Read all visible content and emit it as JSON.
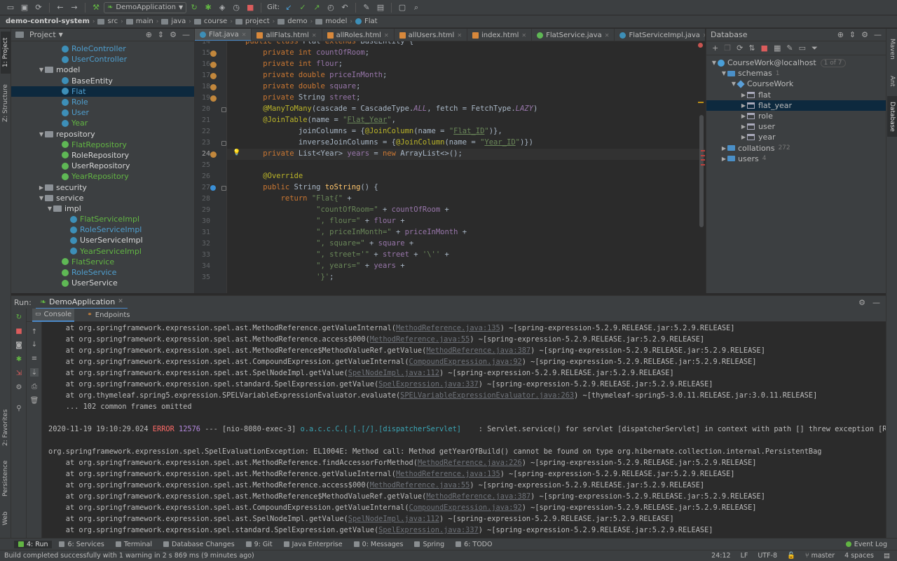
{
  "toolbar": {
    "run_config": "DemoApplication",
    "git_label": "Git:"
  },
  "breadcrumb": [
    "demo-control-system",
    "src",
    "main",
    "java",
    "course",
    "project",
    "demo",
    "model",
    "Flat"
  ],
  "left_strip": {
    "project_tab": "1: Project",
    "structure_tab": "Z: Structure",
    "favorites_tab": "2: Favorites",
    "persistence_tab": "Persistence",
    "web_tab": "Web"
  },
  "right_strip": {
    "maven_tab": "Maven",
    "ant_tab": "Ant",
    "database_tab": "Database"
  },
  "project": {
    "title": "Project",
    "tree": [
      {
        "label": "RoleController",
        "kind": "class",
        "color": "blue",
        "indent": 6
      },
      {
        "label": "UserController",
        "kind": "class",
        "color": "blue",
        "indent": 6
      },
      {
        "label": "model",
        "kind": "package",
        "color": "white",
        "indent": 4,
        "open": true
      },
      {
        "label": "BaseEntity",
        "kind": "class",
        "color": "white",
        "indent": 6
      },
      {
        "label": "Flat",
        "kind": "class",
        "color": "blue",
        "indent": 6,
        "selected": true
      },
      {
        "label": "Role",
        "kind": "class",
        "color": "blue",
        "indent": 6
      },
      {
        "label": "User",
        "kind": "class",
        "color": "blue",
        "indent": 6
      },
      {
        "label": "Year",
        "kind": "class",
        "color": "green",
        "indent": 6
      },
      {
        "label": "repository",
        "kind": "package",
        "color": "white",
        "indent": 4,
        "open": true
      },
      {
        "label": "FlatRepository",
        "kind": "interface",
        "color": "green",
        "indent": 6
      },
      {
        "label": "RoleRepository",
        "kind": "interface",
        "color": "white",
        "indent": 6
      },
      {
        "label": "UserRepository",
        "kind": "interface",
        "color": "white",
        "indent": 6
      },
      {
        "label": "YearRepository",
        "kind": "interface",
        "color": "green",
        "indent": 6
      },
      {
        "label": "security",
        "kind": "package",
        "color": "white",
        "indent": 4,
        "open": false
      },
      {
        "label": "service",
        "kind": "package",
        "color": "white",
        "indent": 4,
        "open": true
      },
      {
        "label": "impl",
        "kind": "package",
        "color": "white",
        "indent": 5,
        "open": true
      },
      {
        "label": "FlatServiceImpl",
        "kind": "class",
        "color": "green",
        "indent": 7
      },
      {
        "label": "RoleServiceImpl",
        "kind": "class",
        "color": "blue",
        "indent": 7
      },
      {
        "label": "UserServiceImpl",
        "kind": "class",
        "color": "white",
        "indent": 7
      },
      {
        "label": "YearServiceImpl",
        "kind": "class",
        "color": "green",
        "indent": 7
      },
      {
        "label": "FlatService",
        "kind": "interface",
        "color": "green",
        "indent": 6
      },
      {
        "label": "RoleService",
        "kind": "interface",
        "color": "blue",
        "indent": 6
      },
      {
        "label": "UserService",
        "kind": "interface",
        "color": "white",
        "indent": 6
      }
    ]
  },
  "editor_tabs": [
    {
      "label": "Flat.java",
      "type": "java-c",
      "active": true
    },
    {
      "label": "allFlats.html",
      "type": "html"
    },
    {
      "label": "allRoles.html",
      "type": "html"
    },
    {
      "label": "allUsers.html",
      "type": "html"
    },
    {
      "label": "index.html",
      "type": "html"
    },
    {
      "label": "FlatService.java",
      "type": "java-i"
    },
    {
      "label": "FlatServiceImpl.java",
      "type": "java-c"
    },
    {
      "label": "FlatController.ja",
      "type": "java-c"
    }
  ],
  "editor": {
    "current_line": 24,
    "lines": [
      {
        "n": 14,
        "html": "<span class='kw'>public class</span> Flat <span class='kw'>extends</span> BaseEntity {"
      },
      {
        "n": 15,
        "mark": "field",
        "html": "    <span class='kw'>private int</span> <span class='fld'>countOfRoom</span>;"
      },
      {
        "n": 16,
        "mark": "field",
        "html": "    <span class='kw'>private int</span> <span class='fld'>flour</span>;"
      },
      {
        "n": 17,
        "mark": "field",
        "html": "    <span class='kw'>private double</span> <span class='fld'>priceInMonth</span>;"
      },
      {
        "n": 18,
        "mark": "field",
        "html": "    <span class='kw'>private double</span> <span class='fld'>square</span>;"
      },
      {
        "n": 19,
        "mark": "field",
        "html": "    <span class='kw'>private</span> String <span class='fld'>street</span>;"
      },
      {
        "n": 20,
        "fold": true,
        "html": "    <span class='ann'>@ManyToMany</span>(cascade = CascadeType.<span class='fld ital'>ALL</span>, fetch = FetchType.<span class='fld ital'>LAZY</span>)"
      },
      {
        "n": 21,
        "html": "    <span class='ann'>@JoinTable</span>(name = <span class='str'>\"<span class='uline'>Flat_Year</span>\"</span>,"
      },
      {
        "n": 22,
        "html": "            joinColumns = {<span class='ann'>@JoinColumn</span>(name = <span class='str'>\"<span class='uline'>Flat_ID</span>\"</span>)},"
      },
      {
        "n": 23,
        "fold": true,
        "html": "            inverseJoinColumns = {<span class='ann'>@JoinColumn</span>(name = <span class='str'>\"<span class='uline'>Year_ID</span>\"</span>)})"
      },
      {
        "n": 24,
        "mark": "field",
        "html": "    <span class='kw'>private</span> List&lt;Year&gt; <span class='fld'>years</span> = <span class='kw'>new</span> ArrayList&lt;&gt;();"
      },
      {
        "n": 25,
        "html": ""
      },
      {
        "n": 26,
        "html": "    <span class='ann'>@Override</span>"
      },
      {
        "n": 27,
        "mark": "override",
        "fold": true,
        "html": "    <span class='kw'>public</span> String <span class='fnc'>toString</span>() {"
      },
      {
        "n": 28,
        "html": "        <span class='kw'>return</span> <span class='str'>\"Flat{\"</span> +"
      },
      {
        "n": 29,
        "html": "                <span class='str'>\"countOfRoom=\"</span> + <span class='fld'>countOfRoom</span> +"
      },
      {
        "n": 30,
        "html": "                <span class='str'>\", flour=\"</span> + <span class='fld'>flour</span> +"
      },
      {
        "n": 31,
        "html": "                <span class='str'>\", priceInMonth=\"</span> + <span class='fld'>priceInMonth</span> +"
      },
      {
        "n": 32,
        "html": "                <span class='str'>\", square=\"</span> + <span class='fld'>square</span> +"
      },
      {
        "n": 33,
        "html": "                <span class='str'>\", street='\"</span> + <span class='fld'>street</span> + <span class='str'>'\\''</span> +"
      },
      {
        "n": 34,
        "html": "                <span class='str'>\", years=\"</span> + <span class='fld'>years</span> +"
      },
      {
        "n": 35,
        "html": "                <span class='str'>'}'</span>;"
      }
    ]
  },
  "database": {
    "title": "Database",
    "tree": [
      {
        "label": "CourseWork@localhost",
        "icon": "conn",
        "indent": 0,
        "arrow": "open",
        "badge": "1 of 7"
      },
      {
        "label": "schemas",
        "icon": "folder",
        "indent": 1,
        "arrow": "open",
        "count": "1"
      },
      {
        "label": "CourseWork",
        "icon": "schema",
        "indent": 2,
        "arrow": "open"
      },
      {
        "label": "flat",
        "icon": "table",
        "indent": 3,
        "arrow": "closed"
      },
      {
        "label": "flat_year",
        "icon": "table",
        "indent": 3,
        "arrow": "closed",
        "selected": true
      },
      {
        "label": "role",
        "icon": "table",
        "indent": 3,
        "arrow": "closed"
      },
      {
        "label": "user",
        "icon": "table",
        "indent": 3,
        "arrow": "closed"
      },
      {
        "label": "year",
        "icon": "table",
        "indent": 3,
        "arrow": "closed"
      },
      {
        "label": "collations",
        "icon": "folder",
        "indent": 1,
        "arrow": "closed",
        "count": "272"
      },
      {
        "label": "users",
        "icon": "folder",
        "indent": 1,
        "arrow": "closed",
        "count": "4"
      }
    ]
  },
  "run": {
    "label": "Run:",
    "tab": "DemoApplication",
    "subtabs": [
      "Console",
      "Endpoints"
    ]
  },
  "console": [
    {
      "t": "trace",
      "pre": "    at org.springframework.expression.spel.ast.MethodReference.getValueInternal(",
      "link": "MethodReference.java:135",
      "post": ") ~[spring-expression-5.2.9.RELEASE.jar:5.2.9.RELEASE]"
    },
    {
      "t": "trace",
      "pre": "    at org.springframework.expression.spel.ast.MethodReference.access$000(",
      "link": "MethodReference.java:55",
      "post": ") ~[spring-expression-5.2.9.RELEASE.jar:5.2.9.RELEASE]"
    },
    {
      "t": "trace",
      "pre": "    at org.springframework.expression.spel.ast.MethodReference$MethodValueRef.getValue(",
      "link": "MethodReference.java:387",
      "post": ") ~[spring-expression-5.2.9.RELEASE.jar:5.2.9.RELEASE]"
    },
    {
      "t": "trace",
      "pre": "    at org.springframework.expression.spel.ast.CompoundExpression.getValueInternal(",
      "link": "CompoundExpression.java:92",
      "post": ") ~[spring-expression-5.2.9.RELEASE.jar:5.2.9.RELEASE]"
    },
    {
      "t": "trace",
      "pre": "    at org.springframework.expression.spel.ast.SpelNodeImpl.getValue(",
      "link": "SpelNodeImpl.java:112",
      "post": ") ~[spring-expression-5.2.9.RELEASE.jar:5.2.9.RELEASE]"
    },
    {
      "t": "trace",
      "pre": "    at org.springframework.expression.spel.standard.SpelExpression.getValue(",
      "link": "SpelExpression.java:337",
      "post": ") ~[spring-expression-5.2.9.RELEASE.jar:5.2.9.RELEASE]"
    },
    {
      "t": "trace",
      "pre": "    at org.thymeleaf.spring5.expression.SPELVariableExpressionEvaluator.evaluate(",
      "link": "SPELVariableExpressionEvaluator.java:263",
      "post": ") ~[thymeleaf-spring5-3.0.11.RELEASE.jar:3.0.11.RELEASE]"
    },
    {
      "t": "plain",
      "text": "    ... 102 common frames omitted"
    },
    {
      "t": "blank"
    },
    {
      "t": "log",
      "date": "2020-11-19 19:10:29.024",
      "level": "ERROR",
      "pid": "12576",
      "mid": " --- [nio-8080-exec-3] ",
      "logger": "o.a.c.c.C.[.[.[/].[dispatcherServlet]",
      "msg": "    : Servlet.service() for servlet [dispatcherServlet] in context with path [] threw exception [Requ"
    },
    {
      "t": "blank"
    },
    {
      "t": "plain",
      "text": "org.springframework.expression.spel.SpelEvaluationException: EL1004E: Method call: Method getYearOfBuild() cannot be found on type org.hibernate.collection.internal.PersistentBag"
    },
    {
      "t": "trace",
      "pre": "    at org.springframework.expression.spel.ast.MethodReference.findAccessorForMethod(",
      "link": "MethodReference.java:226",
      "post": ") ~[spring-expression-5.2.9.RELEASE.jar:5.2.9.RELEASE]"
    },
    {
      "t": "trace",
      "pre": "    at org.springframework.expression.spel.ast.MethodReference.getValueInternal(",
      "link": "MethodReference.java:135",
      "post": ") ~[spring-expression-5.2.9.RELEASE.jar:5.2.9.RELEASE]"
    },
    {
      "t": "trace",
      "pre": "    at org.springframework.expression.spel.ast.MethodReference.access$000(",
      "link": "MethodReference.java:55",
      "post": ") ~[spring-expression-5.2.9.RELEASE.jar:5.2.9.RELEASE]"
    },
    {
      "t": "trace",
      "pre": "    at org.springframework.expression.spel.ast.MethodReference$MethodValueRef.getValue(",
      "link": "MethodReference.java:387",
      "post": ") ~[spring-expression-5.2.9.RELEASE.jar:5.2.9.RELEASE]"
    },
    {
      "t": "trace",
      "pre": "    at org.springframework.expression.spel.ast.CompoundExpression.getValueInternal(",
      "link": "CompoundExpression.java:92",
      "post": ") ~[spring-expression-5.2.9.RELEASE.jar:5.2.9.RELEASE]"
    },
    {
      "t": "trace",
      "pre": "    at org.springframework.expression.spel.ast.SpelNodeImpl.getValue(",
      "link": "SpelNodeImpl.java:112",
      "post": ") ~[spring-expression-5.2.9.RELEASE.jar:5.2.9.RELEASE]"
    },
    {
      "t": "trace",
      "pre": "    at org.springframework.expression.spel.standard.SpelExpression.getValue(",
      "link": "SpelExpression.java:337",
      "post": ") ~[spring-expression-5.2.9.RELEASE.jar:5.2.9.RELEASE]"
    }
  ],
  "bottom_tools": [
    {
      "label": "4: Run",
      "active": true
    },
    {
      "label": "6: Services"
    },
    {
      "label": "Terminal"
    },
    {
      "label": "Database Changes"
    },
    {
      "label": "9: Git"
    },
    {
      "label": "Java Enterprise"
    },
    {
      "label": "0: Messages"
    },
    {
      "label": "Spring"
    },
    {
      "label": "6: TODO"
    }
  ],
  "event_log": "Event Log",
  "status": {
    "message": "Build completed successfully with 1 warning in 2 s 869 ms (9 minutes ago)",
    "position": "24:12",
    "line_sep": "LF",
    "encoding": "UTF-8",
    "branch": "master",
    "indent": "4 spaces"
  }
}
